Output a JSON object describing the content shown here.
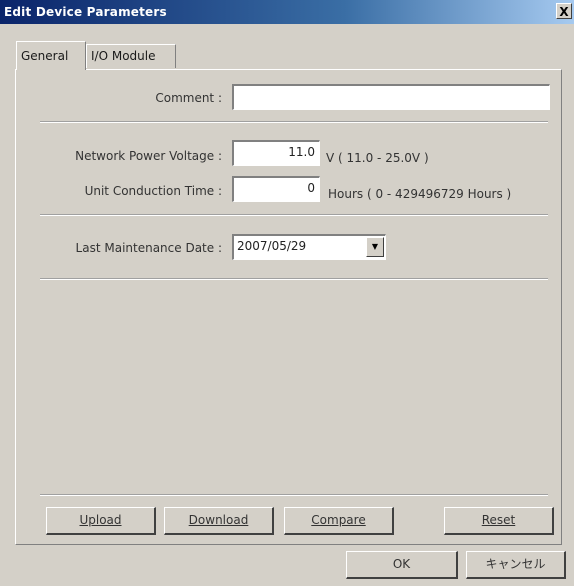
{
  "window": {
    "title": "Edit Device Parameters",
    "close_glyph": "X"
  },
  "tabs": [
    {
      "label": "General",
      "active": true
    },
    {
      "label": "I/O Module",
      "active": false
    }
  ],
  "fields": {
    "comment": {
      "label": "Comment :",
      "value": ""
    },
    "network_voltage": {
      "label": "Network Power Voltage :",
      "value": "11.0",
      "hint": "V ( 11.0 - 25.0V )"
    },
    "conduction_time": {
      "label": "Unit Conduction Time :",
      "value": "0",
      "hint": "Hours ( 0 - 429496729 Hours )"
    },
    "maintenance_date": {
      "label": "Last Maintenance Date :",
      "value": "2007/05/29"
    }
  },
  "action_buttons": {
    "upload": "Upload",
    "download": "Download",
    "compare": "Compare",
    "reset": "Reset"
  },
  "dialog_buttons": {
    "ok": "OK",
    "cancel": "キャンセル"
  },
  "icons": {
    "combo_dropdown": "chevron-down-icon"
  }
}
